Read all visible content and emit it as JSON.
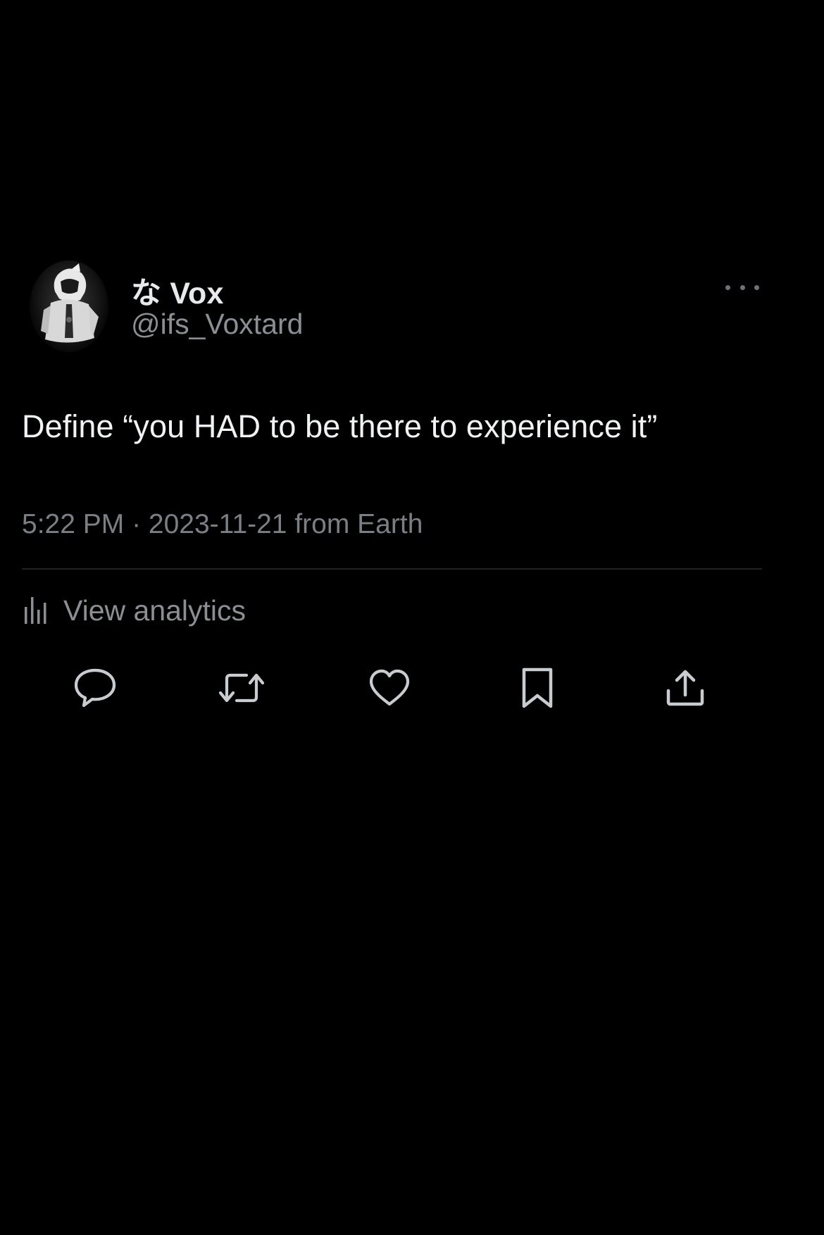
{
  "author": {
    "display_name": "な Vox",
    "handle": "@ifs_Voxtard"
  },
  "tweet": {
    "text": "Define “you HAD to be there to experience it”",
    "timestamp": "5:22 PM · 2023-11-21 from Earth"
  },
  "analytics": {
    "label": "View analytics",
    "icon": "bar-chart-icon"
  },
  "actions": [
    {
      "name": "reply",
      "icon": "speech-bubble-icon"
    },
    {
      "name": "retweet",
      "icon": "retweet-arrows-icon"
    },
    {
      "name": "like",
      "icon": "heart-icon"
    },
    {
      "name": "bookmark",
      "icon": "bookmark-icon"
    },
    {
      "name": "share",
      "icon": "upload-arrow-icon"
    }
  ],
  "colors": {
    "background": "#000000",
    "primary_text": "#e7e9ea",
    "secondary_text": "#8b8f93",
    "icon": "#c9ccce"
  }
}
